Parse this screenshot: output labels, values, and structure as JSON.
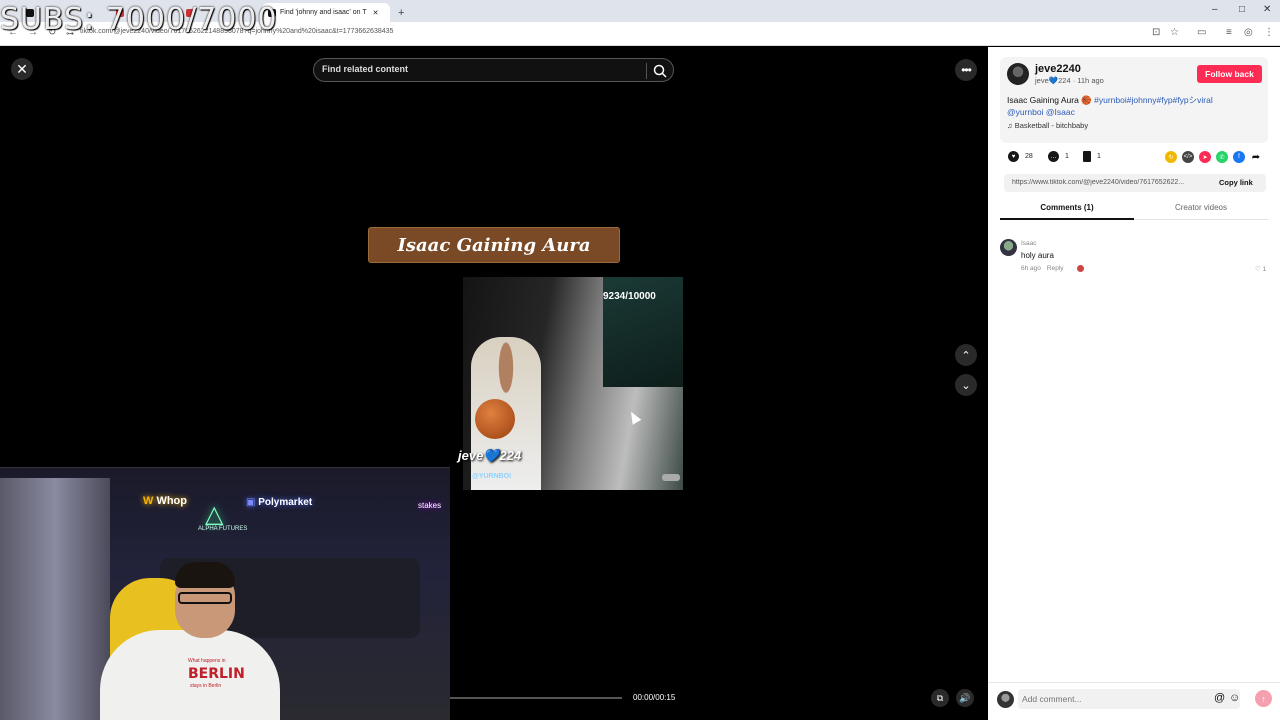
{
  "overlay": {
    "subs_counter": "SUBS: 7000/7000"
  },
  "browser": {
    "tabs": [
      {
        "label": "",
        "active": false
      },
      {
        "label": "",
        "active": false
      },
      {
        "label": "",
        "active": false
      },
      {
        "label": "Find 'johnny and isaac' on T",
        "active": true
      }
    ],
    "new_tab_label": "+",
    "url": "tiktok.com/@jeve2240/video/7617652622148898078?q=johnny%20and%20isaac&t=1773662638435"
  },
  "video": {
    "search_placeholder": "Find related content",
    "title_banner": "Isaac Gaining Aura",
    "counter": "9234/10000",
    "watermark_name": "jeve💙224",
    "watermark_handle": "@YURNBOI",
    "time": "00:00/00:15",
    "more_label": "•••",
    "close_label": "✕",
    "up_label": "⌃",
    "down_label": "⌄"
  },
  "webcam": {
    "logo_whop": "Whop",
    "logo_polymarket": "Polymarket",
    "logo_mid": "△",
    "logo_mid_text": "ALPHA FUTURES",
    "logo_right": "stakes",
    "shirt_top": "What happens in",
    "shirt_main": "BERLIN",
    "shirt_bottom": "stays in Berlin"
  },
  "panel": {
    "author": "jeve2240",
    "author_sub": "jeve💙224 · 11h ago",
    "follow_label": "Follow back",
    "caption_text": "Isaac Gaining Aura 🏀 ",
    "caption_tags": "#yurnboi#johnny#fyp#fypシviral",
    "caption_mentions": "@yurnboi @Isaac",
    "music": "Basketball - bitchbaby",
    "likes": "28",
    "comments": "1",
    "saves": "1",
    "link": "https://www.tiktok.com/@jeve2240/video/7617652622...",
    "copy_link_label": "Copy link",
    "tab_comments": "Comments (1)",
    "tab_creator": "Creator videos",
    "comment": {
      "user": "Isaac",
      "text": "holy aura",
      "time": "6h ago",
      "reply": "Reply",
      "likes": "1"
    },
    "comment_placeholder": "Add comment...",
    "share_colors": [
      "#f0b800",
      "#444444",
      "#fe2c55",
      "#25d366",
      "#1877f2"
    ]
  }
}
